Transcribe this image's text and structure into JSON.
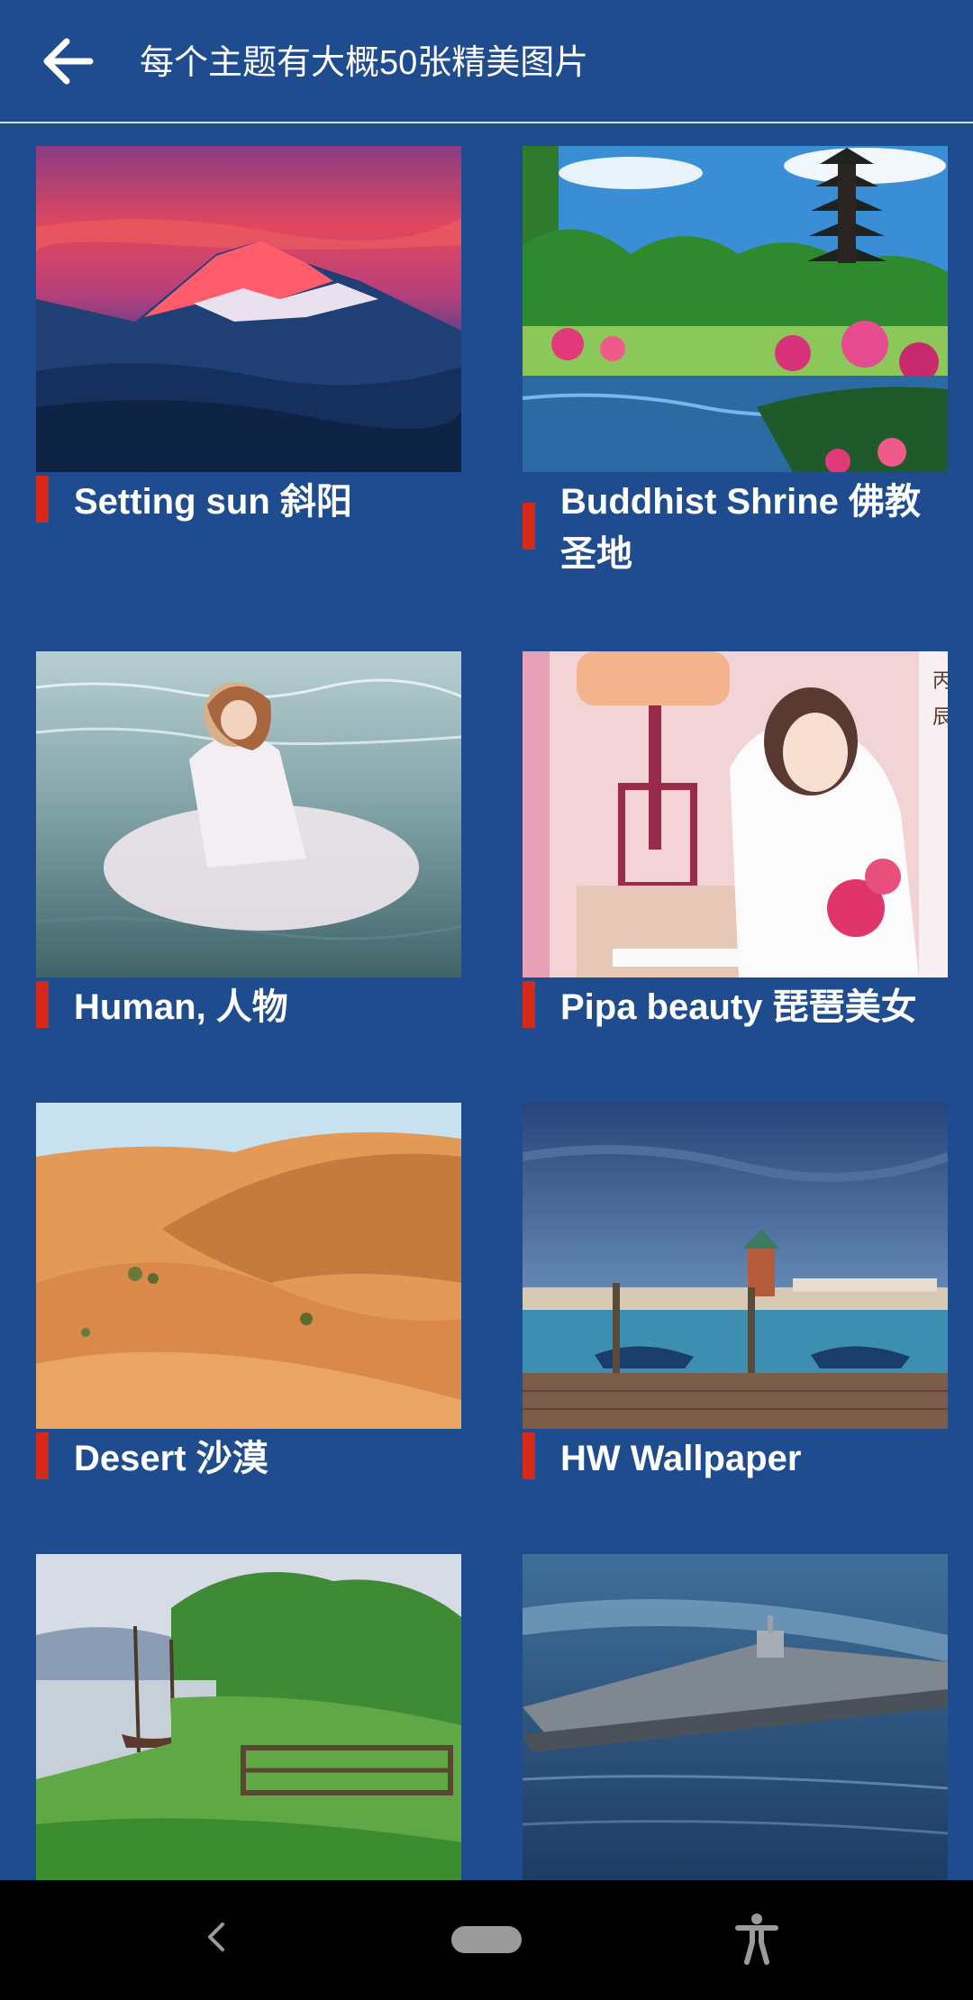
{
  "header": {
    "title": "每个主题有大概50张精美图片",
    "back_icon": "arrow-left-icon"
  },
  "colors": {
    "background": "#1e4c8f",
    "accent_bar": "#d52a1a",
    "nav_bar": "#000000"
  },
  "themes": [
    {
      "label": "Setting sun 斜阳"
    },
    {
      "label": "Buddhist Shrine 佛教圣地"
    },
    {
      "label": "Human, 人物"
    },
    {
      "label": "Pipa beauty 琵琶美女"
    },
    {
      "label": "Desert 沙漠"
    },
    {
      "label": "HW Wallpaper"
    },
    {
      "label": ""
    },
    {
      "label": ""
    }
  ],
  "system_nav": {
    "back_icon": "chevron-left-icon",
    "home_icon": "home-pill-icon",
    "accessibility_icon": "accessibility-icon"
  }
}
